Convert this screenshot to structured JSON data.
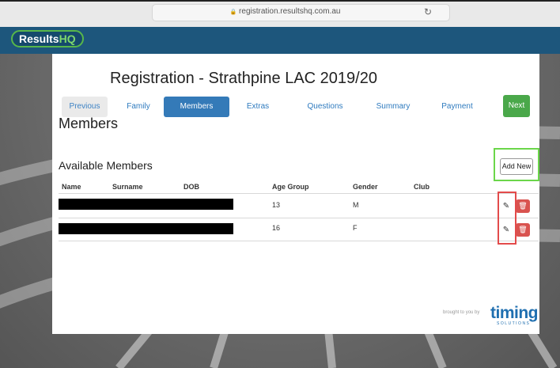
{
  "browser": {
    "url": "registration.resultshq.com.au",
    "lock_glyph": "🔒",
    "reload_glyph": "↻"
  },
  "header": {
    "logo_results": "Results",
    "logo_hq": "HQ"
  },
  "page": {
    "title": "Registration - Strathpine LAC 2019/20",
    "section_title": "Members",
    "subsection_title": "Available Members"
  },
  "steps": [
    {
      "label": "Previous"
    },
    {
      "label": "Family"
    },
    {
      "label": "Members"
    },
    {
      "label": "Extras"
    },
    {
      "label": "Questions"
    },
    {
      "label": "Summary"
    },
    {
      "label": "Payment"
    },
    {
      "label": "Next"
    }
  ],
  "actions": {
    "add_new": "Add New",
    "edit_glyph": "✎",
    "delete_glyph": "🗑"
  },
  "table": {
    "headers": [
      "Name",
      "Surname",
      "DOB",
      "Age Group",
      "Gender",
      "Club"
    ],
    "rows": [
      {
        "name": "",
        "surname": "",
        "dob": "",
        "age_group": "13",
        "gender": "M",
        "club": ""
      },
      {
        "name": "",
        "surname": "",
        "dob": "",
        "age_group": "16",
        "gender": "F",
        "club": ""
      }
    ]
  },
  "footer": {
    "brought": "brought to you by",
    "brand": "timing",
    "brand_sub": "SOLUTIONS"
  },
  "colors": {
    "header_bg": "#1d567c",
    "active_step": "#347ab8",
    "next_button": "#4aa84a",
    "delete_button": "#d9534f",
    "highlight_green": "#6bd64a",
    "highlight_red": "#e34b4b"
  }
}
